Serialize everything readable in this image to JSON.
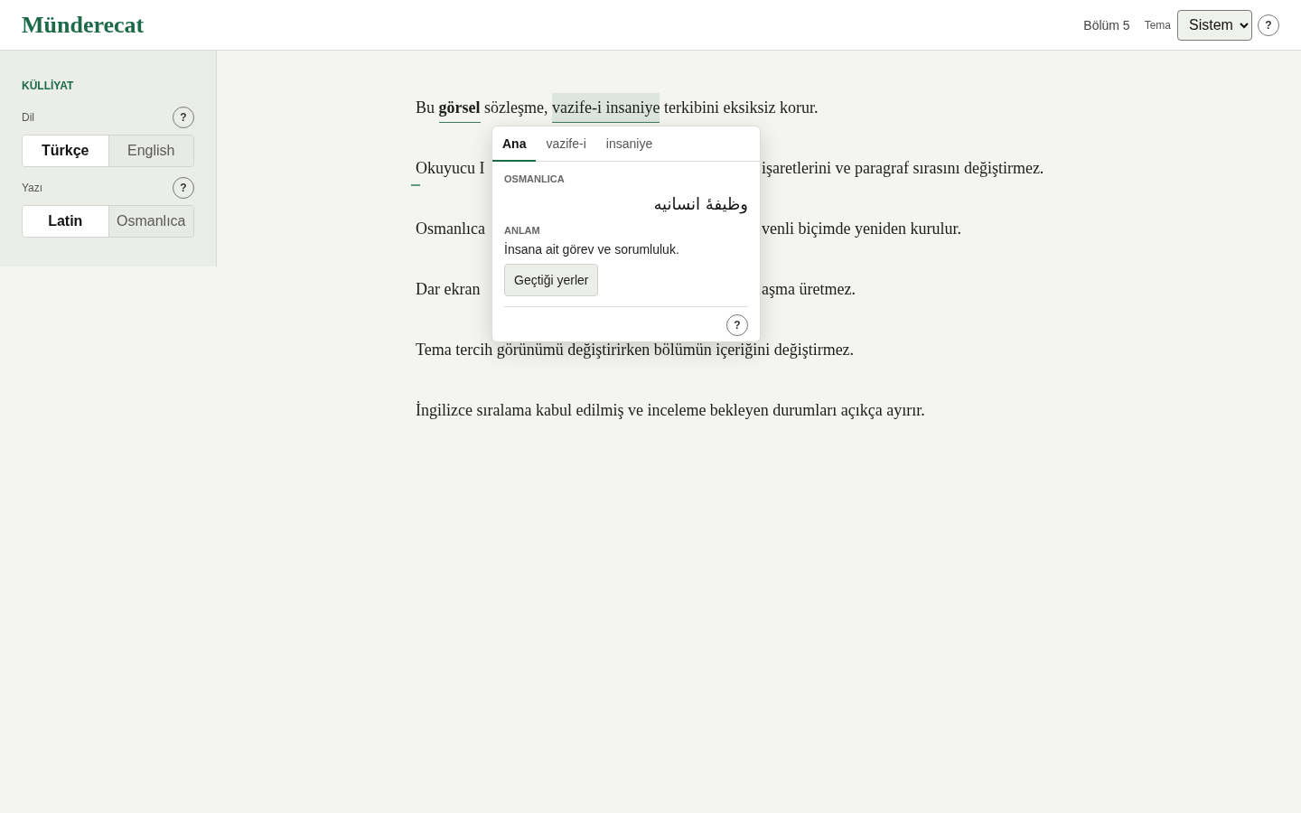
{
  "header": {
    "logo": "Münderecat",
    "chapter": "Bölüm 5",
    "theme_label": "Tema",
    "theme_value": "Sistem",
    "help": "?"
  },
  "sidebar": {
    "title": "KÜLLİYAT",
    "groups": [
      {
        "label": "Dil",
        "help": "?",
        "options": [
          {
            "label": "Türkçe",
            "selected": true
          },
          {
            "label": "English",
            "selected": false
          }
        ]
      },
      {
        "label": "Yazı",
        "help": "?",
        "options": [
          {
            "label": "Latin",
            "selected": true
          },
          {
            "label": "Osmanlıca",
            "selected": false
          }
        ]
      }
    ]
  },
  "paragraphs": [
    {
      "kind": "full",
      "marked": false,
      "segments": [
        {
          "kind": "text",
          "text": "Bu "
        },
        {
          "kind": "term",
          "text": "**görsel**",
          "selected": false
        },
        {
          "kind": "text",
          "text": " sözleşme, "
        },
        {
          "kind": "term",
          "text": "vazife-i insaniye",
          "selected": true
        },
        {
          "kind": "text",
          "text": " terkibini eksiksiz korur."
        }
      ]
    },
    {
      "kind": "split",
      "marked": true,
      "left": "Okuyucu I",
      "right": "işaretlerini ve paragraf sırasını değiştirmez."
    },
    {
      "kind": "split",
      "marked": false,
      "left": "Osmanlıca",
      "right": "venli biçimde yeniden kurulur."
    },
    {
      "kind": "split",
      "marked": false,
      "left": "Dar ekran",
      "right": "aşma üretmez."
    },
    {
      "kind": "full",
      "marked": false,
      "segments": [
        {
          "kind": "text",
          "text": "Tema tercih görünümü değiştirirken bölümün içeriğini değiştirmez."
        }
      ]
    },
    {
      "kind": "full",
      "marked": false,
      "segments": [
        {
          "kind": "text",
          "text": "İngilizce sıralama kabul edilmiş ve inceleme bekleyen durumları açıkça ayırır."
        }
      ]
    }
  ],
  "popover": {
    "tabs": [
      {
        "label": "Ana",
        "selected": true
      },
      {
        "label": "vazife-i",
        "selected": false
      },
      {
        "label": "insaniye",
        "selected": false
      }
    ],
    "script_label": "OSMANLICA",
    "script_text": "وظیفهٔ انسانیه",
    "meaning_label": "ANLAM",
    "meaning": "İnsana ait görev ve sorumluluk.",
    "button": "Geçtiği yerler",
    "help": "?"
  }
}
